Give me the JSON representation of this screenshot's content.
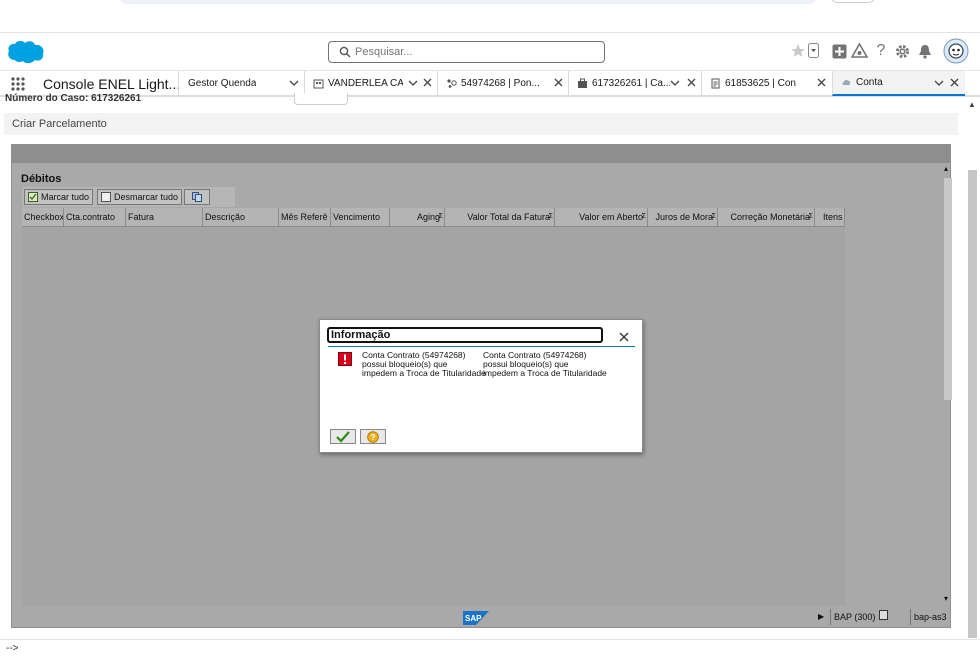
{
  "header": {
    "search_placeholder": "Pesquisar..."
  },
  "tabbar": {
    "app_name": "Console ENEL Light...",
    "tabs": [
      {
        "label": "Gestor Quenda"
      },
      {
        "label": "VANDERLEA CA..."
      },
      {
        "label": "54974268 | Pon..."
      },
      {
        "label": "617326261 | Ca..."
      },
      {
        "label": "61853625 | Con..."
      },
      {
        "label": "Conta"
      }
    ]
  },
  "content": {
    "case_number_partial": "Número do Caso: 617326261",
    "section_title": "Criar Parcelamento"
  },
  "sap": {
    "grid_title": "Débitos",
    "toolbar": {
      "select_all": "Marcar tudo",
      "deselect_all": "Desmarcar tudo"
    },
    "columns": [
      "Checkbox",
      "Cta.contrato",
      "Fatura",
      "Descrição",
      "Mês Referê",
      "Vencimento",
      "Aging",
      "Valor Total da Fatura",
      "Valor em Aberto",
      "Juros de Mora",
      "Correção Monetária",
      "Itens"
    ],
    "status": {
      "system": "BAP (300)",
      "server": "bap-as3"
    }
  },
  "dialog": {
    "title": "Informação",
    "message_a": [
      "Conta Contrato (54974268)",
      "possui bloqueio(s) que",
      "impedem a Troca de Titularidade"
    ],
    "message_b": [
      "Conta Contrato (54974268)",
      "possui bloqueio(s) que",
      "impedem a Troca de Titularidade"
    ]
  },
  "footer": {
    "prompt": "-->"
  },
  "colors": {
    "sf_blue": "#0176d3",
    "logo_blue": "#00a1e0",
    "sap_bg": "#a9a9a9",
    "error_red": "#d9001b"
  }
}
